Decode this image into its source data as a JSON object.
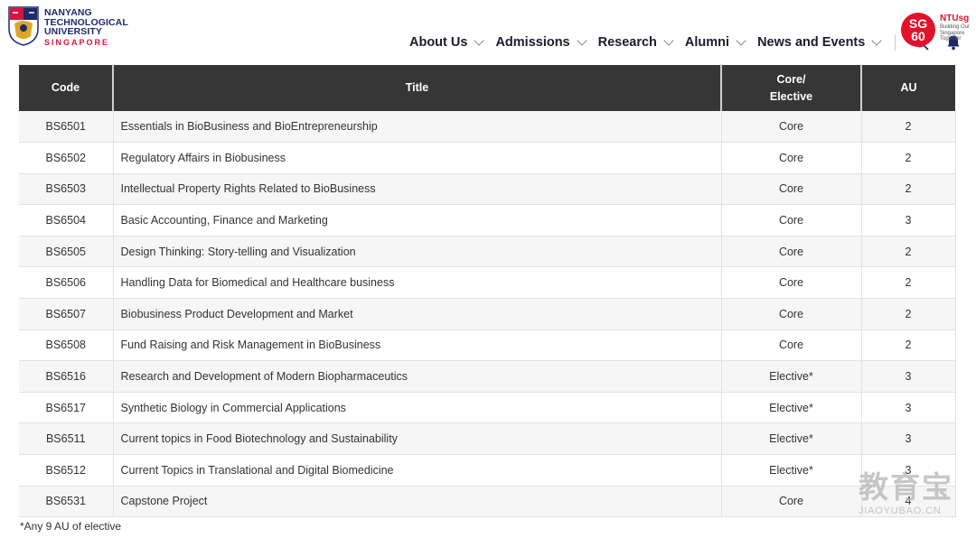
{
  "header": {
    "logo": {
      "line1": "NANYANG",
      "line2": "TECHNOLOGICAL",
      "line3": "UNIVERSITY",
      "line4": "SINGAPORE"
    },
    "nav": [
      {
        "label": "About Us"
      },
      {
        "label": "Admissions"
      },
      {
        "label": "Research"
      },
      {
        "label": "Alumni"
      },
      {
        "label": "News and Events"
      }
    ],
    "badge": {
      "sg": "SG",
      "sixty": "60",
      "brand": "NTUsg",
      "tagline": "Building Our Singapore Together"
    }
  },
  "table": {
    "headers": {
      "code": "Code",
      "title": "Title",
      "type_line1": "Core/",
      "type_line2": "Elective",
      "au": "AU"
    },
    "rows": [
      {
        "code": "BS6501",
        "title": "Essentials in BioBusiness and BioEntrepreneurship",
        "type": "Core",
        "au": "2"
      },
      {
        "code": "BS6502",
        "title": "Regulatory Affairs in Biobusiness",
        "type": "Core",
        "au": "2"
      },
      {
        "code": "BS6503",
        "title": "Intellectual Property Rights Related to BioBusiness",
        "type": "Core",
        "au": "2"
      },
      {
        "code": "BS6504",
        "title": "Basic Accounting, Finance and Marketing",
        "type": "Core",
        "au": "3"
      },
      {
        "code": "BS6505",
        "title": "Design Thinking: Story-telling and Visualization",
        "type": "Core",
        "au": "2"
      },
      {
        "code": "BS6506",
        "title": "Handling Data for Biomedical and Healthcare business",
        "type": "Core",
        "au": "2"
      },
      {
        "code": "BS6507",
        "title": "Biobusiness Product Development and Market",
        "type": "Core",
        "au": "2"
      },
      {
        "code": "BS6508",
        "title": "Fund Raising and Risk Management in BioBusiness",
        "type": "Core",
        "au": "2"
      },
      {
        "code": "BS6516",
        "title": "Research and Development of Modern Biopharmaceutics",
        "type": "Elective*",
        "au": "3"
      },
      {
        "code": "BS6517",
        "title": "Synthetic Biology in Commercial Applications",
        "type": "Elective*",
        "au": "3"
      },
      {
        "code": "BS6511",
        "title": "Current topics in Food Biotechnology and Sustainability",
        "type": "Elective*",
        "au": "3"
      },
      {
        "code": "BS6512",
        "title": "Current Topics in Translational and Digital Biomedicine",
        "type": "Elective*",
        "au": "3"
      },
      {
        "code": "BS6531",
        "title": "Capstone Project",
        "type": "Core",
        "au": "4"
      }
    ]
  },
  "footnote": "*Any 9 AU of elective",
  "watermark": {
    "cn": "教育宝",
    "en": "JIAOYUBAO.CN"
  },
  "colors": {
    "header_bg": "#363636",
    "ntu_blue": "#1c2a6b",
    "ntu_red": "#d71440",
    "sg60_red": "#e3122b"
  },
  "icons": {
    "search": "search-icon",
    "notification": "bell-icon",
    "chevron": "chevron-down-icon"
  }
}
